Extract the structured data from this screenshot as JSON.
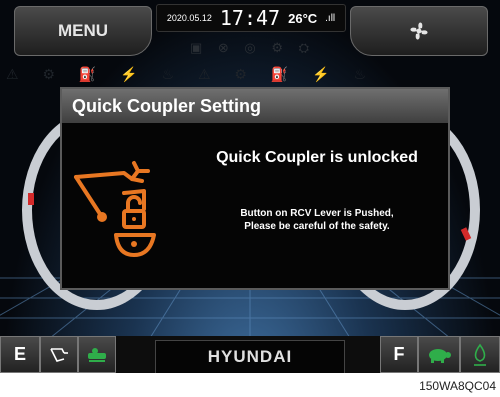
{
  "topbar": {
    "menu_label": "MENU",
    "date": "2020.05.12",
    "time": "17:47",
    "temperature": "26°C",
    "signal": ".ıll"
  },
  "dialog": {
    "title": "Quick Coupler Setting",
    "heading": "Quick Coupler is unlocked",
    "message_line1": "Button on RCV Lever is Pushed,",
    "message_line2": "Please be careful of the safety."
  },
  "bottombar": {
    "left_label": "E",
    "brand": "HYUNDAI",
    "right_label": "F"
  },
  "caption": "150WA8QC04",
  "colors": {
    "warning_orange": "#e87722",
    "active_green": "#2fae4a",
    "gauge_red": "#d42a2a"
  }
}
